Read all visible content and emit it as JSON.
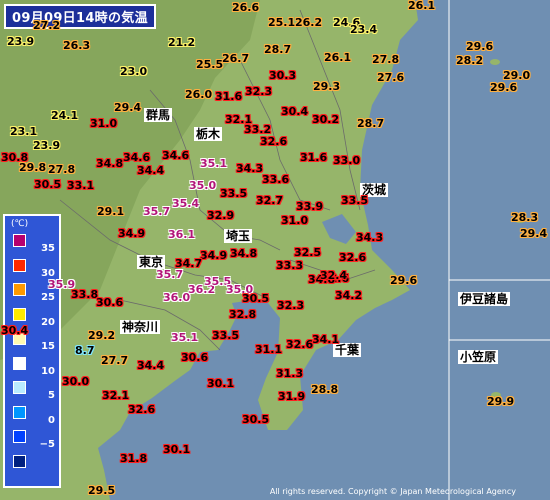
{
  "map": {
    "title": "09月09日14時の気温",
    "copyright": "All rights reserved. Copyright © Japan Meteorological Agency",
    "colors": {
      "sea": "#6f8fb2",
      "land": "#96b56a",
      "land_dark": "#7f9f57",
      "border": "#6b6b6b"
    }
  },
  "legend": {
    "unit": "(℃)",
    "items": [
      {
        "label": "35",
        "color": "#b4006e"
      },
      {
        "label": "30",
        "color": "#ff2800"
      },
      {
        "label": "25",
        "color": "#ff9900"
      },
      {
        "label": "20",
        "color": "#ffea00"
      },
      {
        "label": "15",
        "color": "#fff9b0"
      },
      {
        "label": "10",
        "color": "#ffffff"
      },
      {
        "label": "5",
        "color": "#b9ebff"
      },
      {
        "label": "0",
        "color": "#0096ff"
      },
      {
        "label": "−5",
        "color": "#0041ff"
      },
      {
        "label": "",
        "color": "#002080"
      }
    ]
  },
  "places": [
    "群馬",
    "栃木",
    "茨城",
    "埼玉",
    "東京",
    "千葉",
    "神奈川",
    "伊豆諸島",
    "小笠原"
  ],
  "readings": [
    "26.6",
    "25.1",
    "26.2",
    "24.6",
    "26.1",
    "21.2",
    "26.3",
    "28.7",
    "25.5",
    "26.7",
    "23.4",
    "29.6",
    "28.2",
    "23.0",
    "30.3",
    "26.1",
    "27.8",
    "29.0",
    "27.6",
    "29.6",
    "26.0",
    "31.6",
    "32.3",
    "29.3",
    "29.4",
    "30.4",
    "32.1",
    "30.2",
    "24.1",
    "31.0",
    "33.2",
    "28.7",
    "23.1",
    "32.6",
    "23.9",
    "34.6",
    "34.6",
    "31.6",
    "33.0",
    "30.8",
    "34.8",
    "35.1",
    "34.3",
    "29.8",
    "27.8",
    "34.4",
    "33.6",
    "30.5",
    "33.1",
    "35.0",
    "33.5",
    "32.7",
    "35.7",
    "35.4",
    "33.9",
    "33.5",
    "29.1",
    "31.0",
    "32.9",
    "28.3",
    "29.4",
    "34.9",
    "36.1",
    "34.3",
    "34.8",
    "34.9",
    "34.7",
    "32.5",
    "32.6",
    "32.6",
    "35.7",
    "33.3",
    "29.6",
    "35.9",
    "36.2",
    "35.5",
    "35.0",
    "34.8",
    "33.8",
    "36.0",
    "30.5",
    "32.4",
    "34.2",
    "30.6",
    "32.3",
    "32.8",
    "29.2",
    "35.1",
    "33.5",
    "34.1",
    "31.1",
    "32.6",
    "27.7",
    "30.6",
    "34.4",
    "31.3",
    "30.0",
    "30.1",
    "31.9",
    "28.8",
    "32.1",
    "32.6",
    "30.5",
    "30.1",
    "31.8",
    "29.5",
    "29.9",
    "8.7",
    "30.4",
    "27.2",
    "23.9"
  ]
}
